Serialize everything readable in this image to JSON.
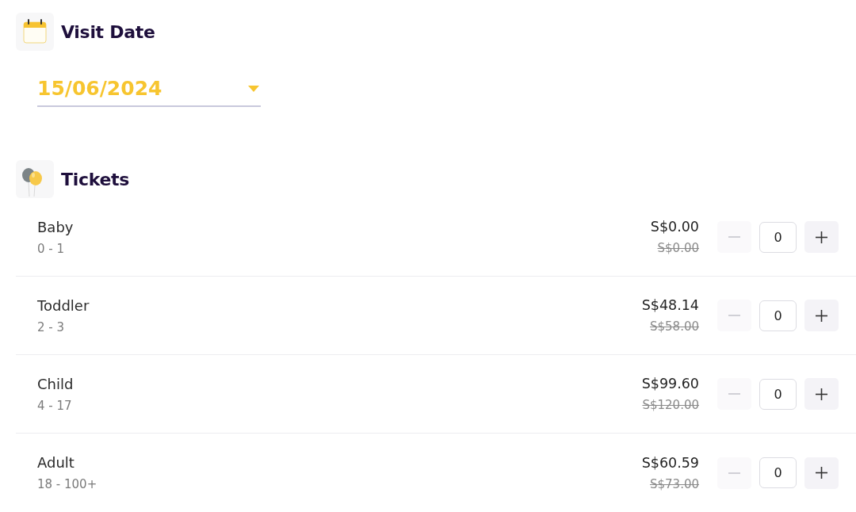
{
  "visit_date": {
    "title": "Visit Date",
    "value": "15/06/2024"
  },
  "tickets": {
    "title": "Tickets",
    "items": [
      {
        "name": "Baby",
        "ages": "0 - 1",
        "price": "S$0.00",
        "original_price": "S$0.00",
        "quantity": "0",
        "decrease_disabled": true
      },
      {
        "name": "Toddler",
        "ages": "2 - 3",
        "price": "S$48.14",
        "original_price": "S$58.00",
        "quantity": "0",
        "decrease_disabled": true
      },
      {
        "name": "Child",
        "ages": "4 - 17",
        "price": "S$99.60",
        "original_price": "S$120.00",
        "quantity": "0",
        "decrease_disabled": true
      },
      {
        "name": "Adult",
        "ages": "18 - 100+",
        "price": "S$60.59",
        "original_price": "S$73.00",
        "quantity": "0",
        "decrease_disabled": true
      }
    ]
  }
}
